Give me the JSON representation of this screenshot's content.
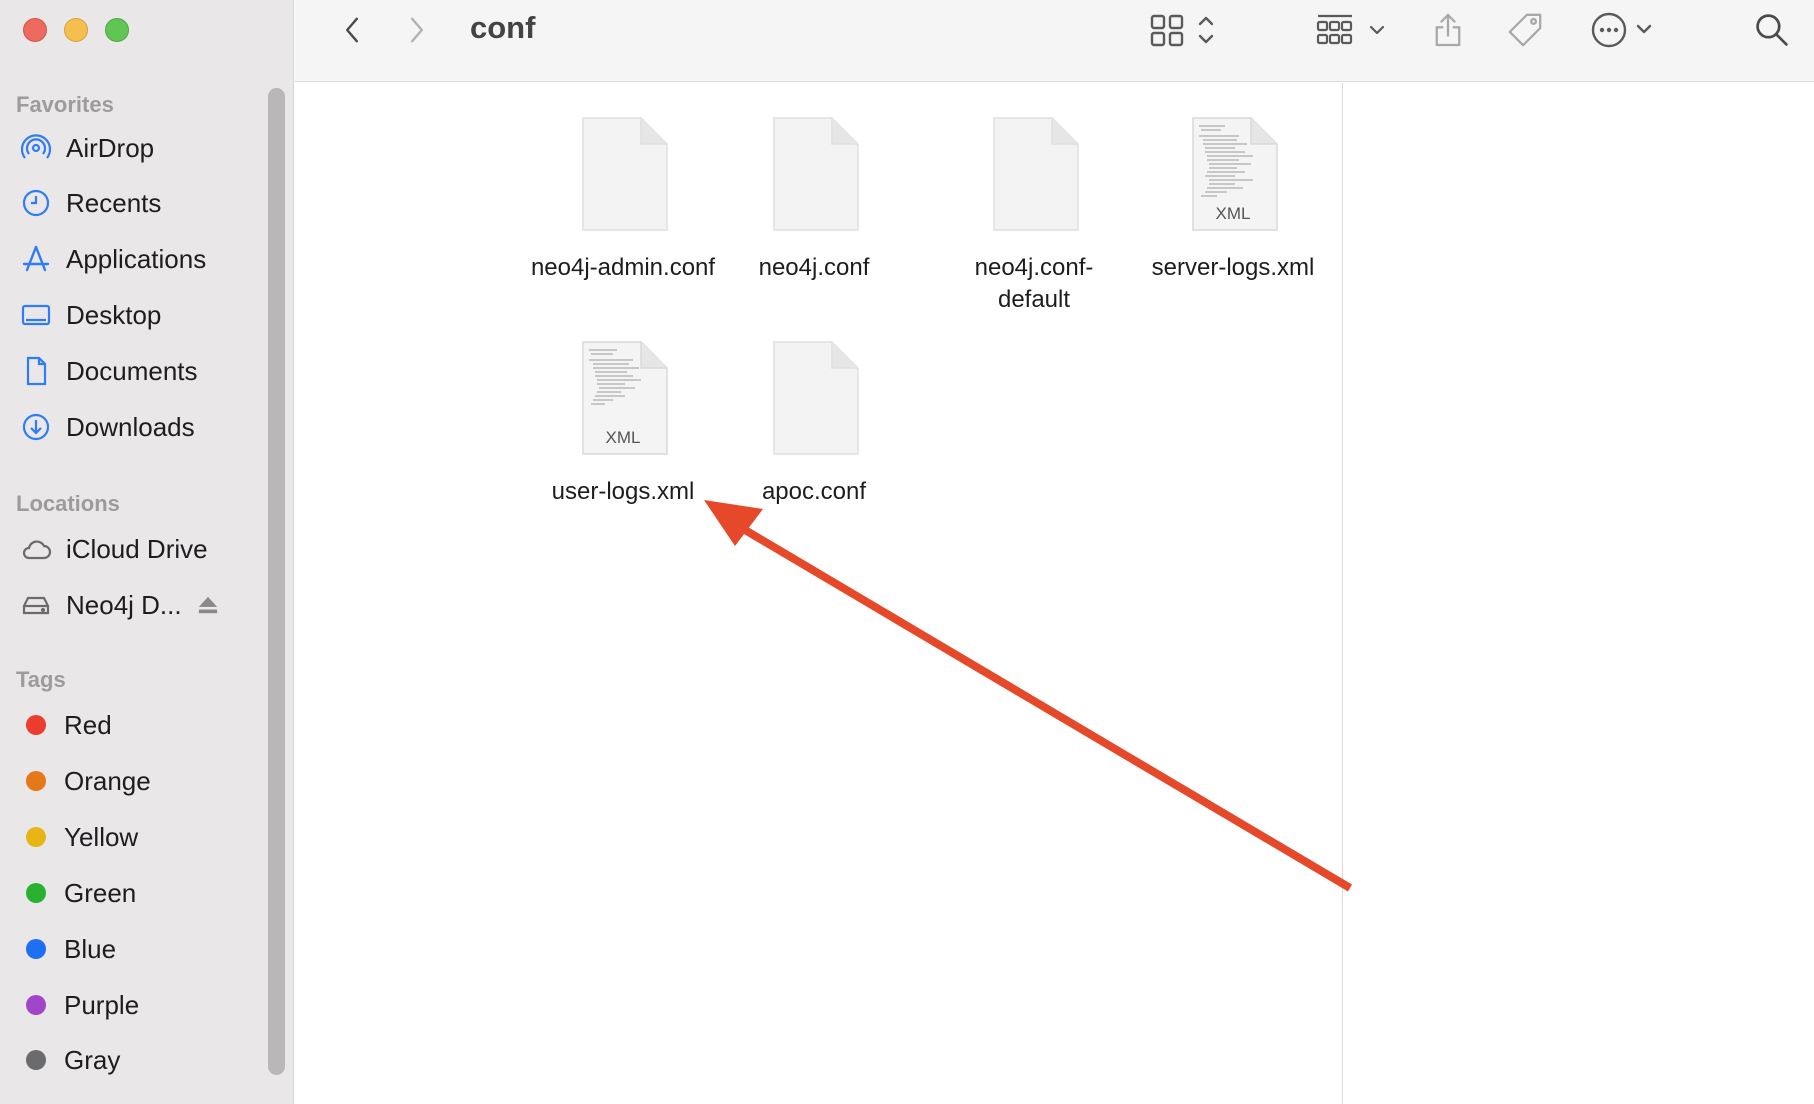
{
  "window": {
    "title": "conf"
  },
  "sidebar": {
    "favorites_title": "Favorites",
    "favorites": [
      {
        "label": "AirDrop",
        "icon": "airdrop-icon"
      },
      {
        "label": "Recents",
        "icon": "clock-icon"
      },
      {
        "label": "Applications",
        "icon": "applications-icon"
      },
      {
        "label": "Desktop",
        "icon": "desktop-icon"
      },
      {
        "label": "Documents",
        "icon": "document-icon"
      },
      {
        "label": "Downloads",
        "icon": "download-icon"
      }
    ],
    "locations_title": "Locations",
    "locations": [
      {
        "label": "iCloud Drive",
        "icon": "cloud-icon"
      },
      {
        "label": "Neo4j D...",
        "icon": "drive-icon"
      }
    ],
    "tags_title": "Tags",
    "tags": [
      {
        "label": "Red",
        "color": "#ec3b2f"
      },
      {
        "label": "Orange",
        "color": "#e57918"
      },
      {
        "label": "Yellow",
        "color": "#e7b614"
      },
      {
        "label": "Green",
        "color": "#29b22f"
      },
      {
        "label": "Blue",
        "color": "#1f6ff2"
      },
      {
        "label": "Purple",
        "color": "#a046ca"
      },
      {
        "label": "Gray",
        "color": "#6b6b6e"
      }
    ]
  },
  "files": [
    {
      "name": "neo4j-admin.conf",
      "type": "conf"
    },
    {
      "name": "neo4j.conf",
      "type": "conf"
    },
    {
      "name": "neo4j.conf-\ndefault",
      "type": "conf"
    },
    {
      "name": "server-logs.xml",
      "type": "xml",
      "badge": "XML"
    },
    {
      "name": "user-logs.xml",
      "type": "xml",
      "badge": "XML"
    },
    {
      "name": "apoc.conf",
      "type": "conf"
    }
  ],
  "annotation": {
    "color": "#e5492a",
    "points_to": "apoc.conf"
  }
}
